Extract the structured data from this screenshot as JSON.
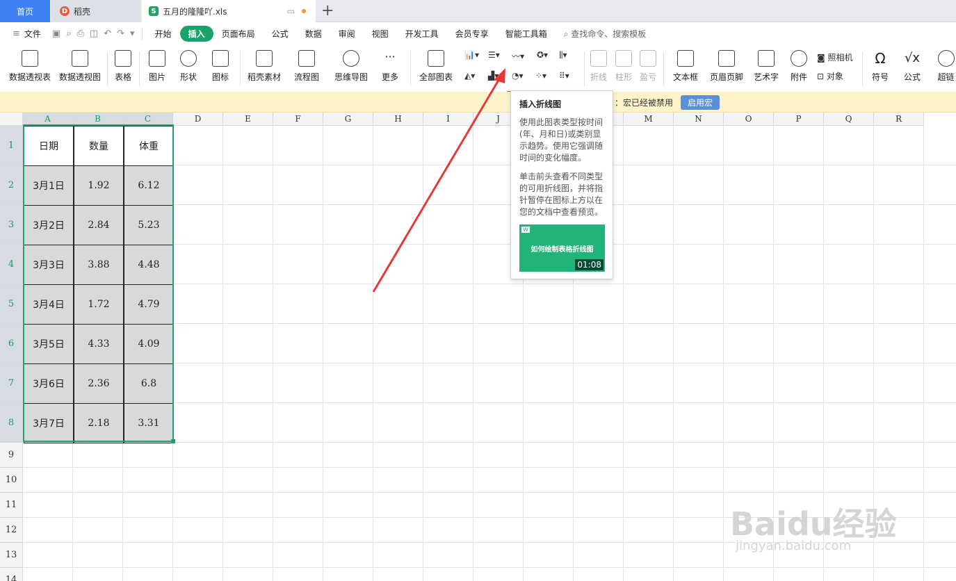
{
  "tabs": {
    "home": "首页",
    "daoke": "稻壳",
    "file": "五月的隆隆吖.xls"
  },
  "menu": {
    "file": "文件",
    "items": [
      "开始",
      "插入",
      "页面布局",
      "公式",
      "数据",
      "审阅",
      "视图",
      "开发工具",
      "会员专享",
      "智能工具箱"
    ],
    "active": "插入",
    "search": "查找命令、搜索模板"
  },
  "ribbon": {
    "pivot_table": "数据透视表",
    "pivot_chart": "数据透视图",
    "table": "表格",
    "picture": "图片",
    "shape": "形状",
    "icon": "图标",
    "daoke_material": "稻壳素材",
    "flowchart": "流程图",
    "mindmap": "思维导图",
    "more": "更多",
    "all_charts": "全部图表",
    "spark_line": "折线",
    "spark_bar": "柱形",
    "spark_winloss": "盈亏",
    "textbox": "文本框",
    "header_footer": "页眉页脚",
    "wordart": "艺术字",
    "attachment": "附件",
    "camera": "照相机",
    "object": "对象",
    "symbol": "符号",
    "formula": "公式",
    "hyperlink": "超链"
  },
  "macro": {
    "message": "：宏已经被禁用",
    "button": "启用宏"
  },
  "tooltip": {
    "title": "插入折线图",
    "p1": "使用此图表类型按时间(年、月和日)或类别显示趋势。使用它强调随时间的变化幅度。",
    "p2": "单击前头查看不同类型的可用折线图，并将指针暂停在图标上方以在您的文档中查看预览。",
    "video_title": "如何绘制表格折线图",
    "video_duration": "01:08"
  },
  "columns": [
    "A",
    "B",
    "C",
    "D",
    "E",
    "F",
    "G",
    "H",
    "I",
    "J",
    "K",
    "L",
    "M",
    "N",
    "O",
    "P",
    "Q",
    "R"
  ],
  "rows": [
    "1",
    "2",
    "3",
    "4",
    "5",
    "6",
    "7",
    "8",
    "9",
    "10",
    "11",
    "12",
    "13",
    "14"
  ],
  "table": {
    "headers": [
      "日期",
      "数量",
      "体重"
    ],
    "rows": [
      [
        "3月1日",
        "1.92",
        "6.12"
      ],
      [
        "3月2日",
        "2.84",
        "5.23"
      ],
      [
        "3月3日",
        "3.88",
        "4.48"
      ],
      [
        "3月4日",
        "1.72",
        "4.79"
      ],
      [
        "3月5日",
        "4.33",
        "4.09"
      ],
      [
        "3月6日",
        "2.36",
        "6.8"
      ],
      [
        "3月7日",
        "2.18",
        "3.31"
      ]
    ]
  },
  "watermark": {
    "brand": "Baidu经验",
    "url": "jingyan.baidu.com"
  },
  "colors": {
    "accent": "#19a36b",
    "tab_home": "#3f82f4",
    "annotation": "#e53935"
  }
}
